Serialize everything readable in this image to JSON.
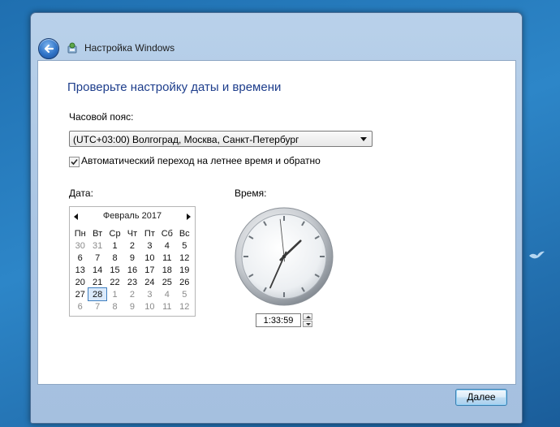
{
  "window": {
    "title": "Настройка Windows"
  },
  "page": {
    "heading": "Проверьте настройку даты и времени",
    "timezone_label": "Часовой пояс:",
    "timezone_value": "(UTC+03:00) Волгоград, Москва, Санкт-Петербург",
    "dst_label": "Автоматический переход на летнее время и обратно",
    "dst_checked": true,
    "date_label": "Дата:",
    "time_label": "Время:"
  },
  "calendar": {
    "month_label": "Февраль 2017",
    "weekdays": [
      "Пн",
      "Вт",
      "Ср",
      "Чт",
      "Пт",
      "Сб",
      "Вс"
    ],
    "weeks": [
      [
        "30",
        "31",
        "1",
        "2",
        "3",
        "4",
        "5"
      ],
      [
        "6",
        "7",
        "8",
        "9",
        "10",
        "11",
        "12"
      ],
      [
        "13",
        "14",
        "15",
        "16",
        "17",
        "18",
        "19"
      ],
      [
        "20",
        "21",
        "22",
        "23",
        "24",
        "25",
        "26"
      ],
      [
        "27",
        "28",
        "1",
        "2",
        "3",
        "4",
        "5"
      ],
      [
        "6",
        "7",
        "8",
        "9",
        "10",
        "11",
        "12"
      ]
    ],
    "other_month": [
      [
        true,
        true,
        false,
        false,
        false,
        false,
        false
      ],
      [
        false,
        false,
        false,
        false,
        false,
        false,
        false
      ],
      [
        false,
        false,
        false,
        false,
        false,
        false,
        false
      ],
      [
        false,
        false,
        false,
        false,
        false,
        false,
        false
      ],
      [
        false,
        false,
        true,
        true,
        true,
        true,
        true
      ],
      [
        true,
        true,
        true,
        true,
        true,
        true,
        true
      ]
    ],
    "selected_day": "28"
  },
  "clock": {
    "hour": 1,
    "minute": 33,
    "second": 59
  },
  "time_value": "1:33:59",
  "buttons": {
    "next_label": "Далее"
  }
}
